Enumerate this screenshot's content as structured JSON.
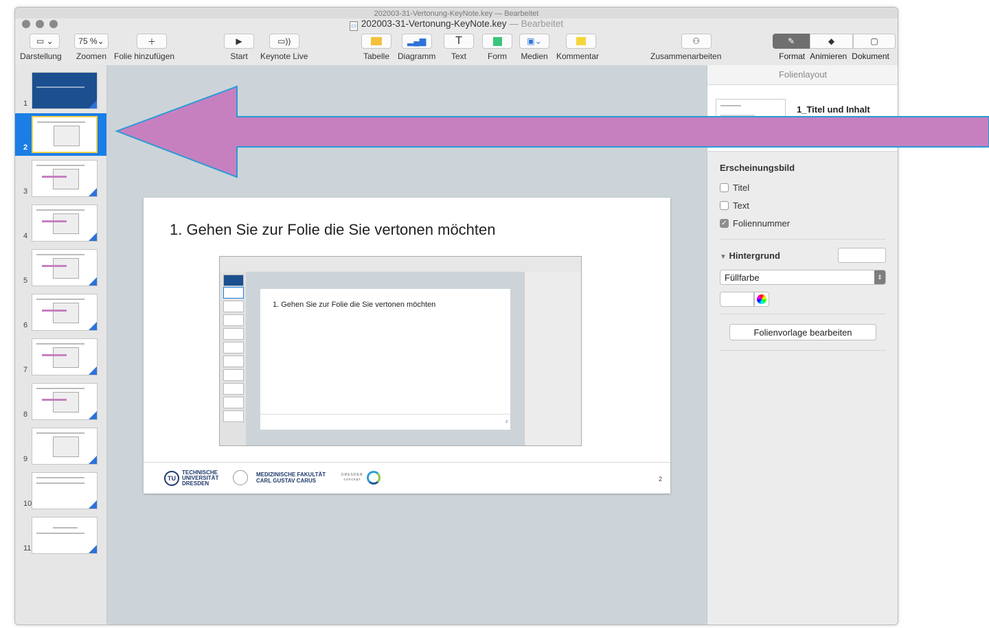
{
  "window": {
    "ghost_title": "202003-31-Vertonung-KeyNote.key — Bearbeitet",
    "title": "202003-31-Vertonung-KeyNote.key",
    "title_sep": " — ",
    "edited": "Bearbeitet"
  },
  "toolbar": {
    "view_label": "Darstellung",
    "zoom_value": "75 %",
    "zoom_label": "Zoomen",
    "add_slide_label": "Folie hinzufügen",
    "start_label": "Start",
    "keynote_live_label": "Keynote Live",
    "table_label": "Tabelle",
    "chart_label": "Diagramm",
    "text_label": "Text",
    "shape_label": "Form",
    "media_label": "Medien",
    "comment_label": "Kommentar",
    "collaborate_label": "Zusammenarbeiten",
    "format_label": "Format",
    "animate_label": "Animieren",
    "document_label": "Dokument"
  },
  "navigator": {
    "slides": [
      {
        "num": "1"
      },
      {
        "num": "2"
      },
      {
        "num": "3"
      },
      {
        "num": "4"
      },
      {
        "num": "5"
      },
      {
        "num": "6"
      },
      {
        "num": "7"
      },
      {
        "num": "8"
      },
      {
        "num": "9"
      },
      {
        "num": "10"
      },
      {
        "num": "11"
      }
    ],
    "selected": "2"
  },
  "slide": {
    "title": "1. Gehen Sie zur Folie die Sie vertonen möchten",
    "inner_title": "1. Gehen Sie zur Folie die Sie vertonen möchten",
    "inner_num": "2",
    "logo_tu": [
      "TECHNISCHE",
      "UNIVERSITÄT",
      "DRESDEN"
    ],
    "logo_med": [
      "MEDIZINISCHE FAKULTÄT",
      "CARL GUSTAV CARUS"
    ],
    "logo_dc": [
      "DRESDEN",
      "concept"
    ],
    "number": "2"
  },
  "inspector": {
    "header": "Folienlayout",
    "layout_name": "1_Titel und Inhalt",
    "appearance_title": "Erscheinungsbild",
    "check_title": "Titel",
    "check_text": "Text",
    "check_number": "Foliennummer",
    "background_title": "Hintergrund",
    "fill_select": "Füllfarbe",
    "edit_master_button": "Folienvorlage bearbeiten"
  },
  "colors": {
    "annotation_arrow": "#c680c0",
    "annotation_stroke": "#2a9ad6",
    "selection": "#1a7ee6"
  }
}
